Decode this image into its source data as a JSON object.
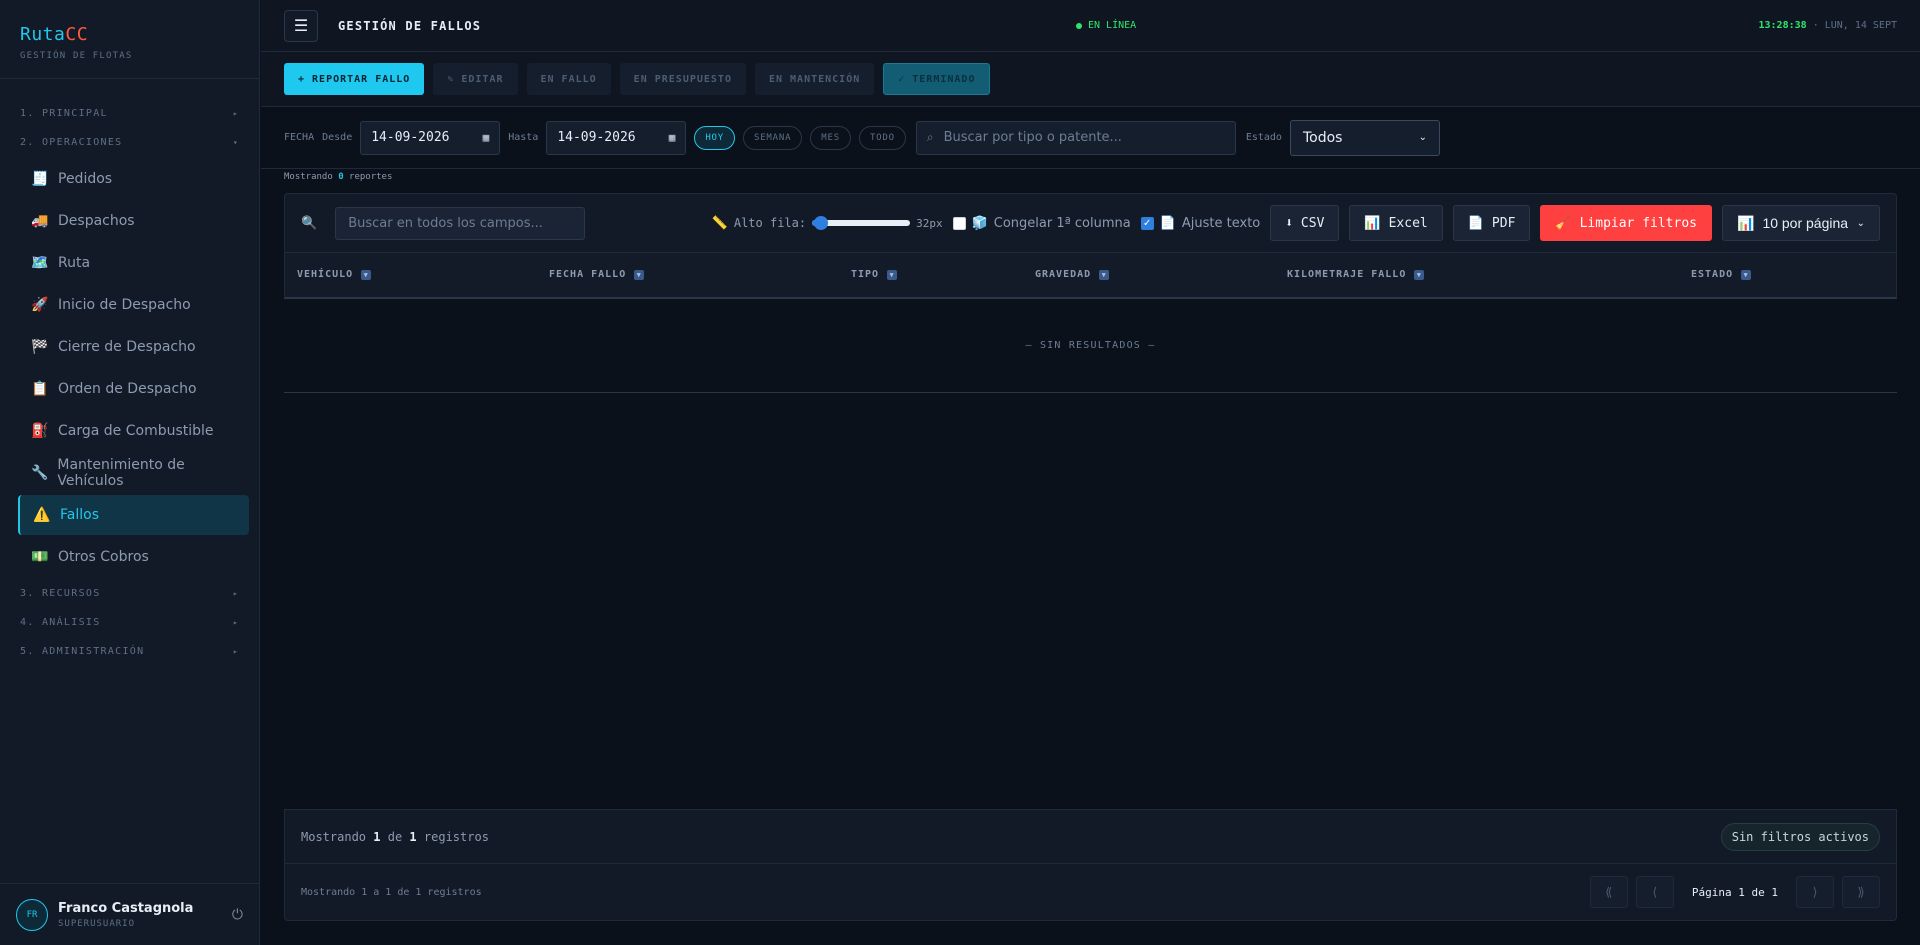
{
  "brand": {
    "name_a": "Ruta",
    "name_b": "CC",
    "subtitle": "GESTIÓN DE FLOTAS"
  },
  "sidebar": {
    "sections": [
      {
        "label": "1. PRINCIPAL",
        "arrow": "▸"
      },
      {
        "label": "2. OPERACIONES",
        "arrow": "▾"
      },
      {
        "label": "3. RECURSOS",
        "arrow": "▸"
      },
      {
        "label": "4. ANÁLISIS",
        "arrow": "▸"
      },
      {
        "label": "5. ADMINISTRACIÓN",
        "arrow": "▸"
      }
    ],
    "items": [
      {
        "label": "Pedidos",
        "icon": "🧾"
      },
      {
        "label": "Despachos",
        "icon": "🚚"
      },
      {
        "label": "Ruta",
        "icon": "🗺️"
      },
      {
        "label": "Inicio de Despacho",
        "icon": "🚀"
      },
      {
        "label": "Cierre de Despacho",
        "icon": "🏁"
      },
      {
        "label": "Orden de Despacho",
        "icon": "📋"
      },
      {
        "label": "Carga de Combustible",
        "icon": "⛽"
      },
      {
        "label": "Mantenimiento de Vehículos",
        "icon": "🔧"
      },
      {
        "label": "Fallos",
        "icon": "⚠️"
      },
      {
        "label": "Otros Cobros",
        "icon": "💵"
      }
    ]
  },
  "user": {
    "initials": "FR",
    "name": "Franco Castagnola",
    "role": "SUPERUSUARIO"
  },
  "header": {
    "title": "GESTIÓN DE FALLOS",
    "status": "EN LÍNEA",
    "time": "13:28:38",
    "date": "· LUN, 14 SEPT"
  },
  "actions": {
    "report": "+ REPORTAR FALLO",
    "edit": "✎ EDITAR",
    "in_fault": "EN FALLO",
    "in_budget": "EN PRESUPUESTO",
    "in_maintenance": "EN MANTENCIÓN",
    "done": "✓ TERMINADO"
  },
  "filters": {
    "fecha": "FECHA",
    "desde": "Desde",
    "hasta": "Hasta",
    "from_date": "14-09-2026",
    "to_date": "14-09-2026",
    "presets": [
      "HOY",
      "SEMANA",
      "MES",
      "TODO"
    ],
    "search_placeholder": "Buscar por tipo o patente...",
    "estado_label": "Estado",
    "estado_value": "Todos"
  },
  "showing": {
    "prefix": "Mostrando",
    "count": "0",
    "suffix": "reportes"
  },
  "grid": {
    "search_placeholder": "Buscar en todos los campos...",
    "row_height_label": "Alto fila:",
    "row_height_value": "32px",
    "freeze_label": "Congelar 1ª columna",
    "wrap_label": "Ajuste texto",
    "csv": "⬇ CSV",
    "excel": "Excel",
    "pdf": "PDF",
    "clear": "Limpiar filtros",
    "per_page": "10 por página",
    "columns": [
      "VEHÍCULO",
      "FECHA FALLO",
      "TIPO",
      "GRAVEDAD",
      "KILOMETRAJE FALLO",
      "ESTADO"
    ],
    "empty": "— SIN RESULTADOS —"
  },
  "footer": {
    "summary_prefix": "Mostrando",
    "summary_a": "1",
    "summary_mid": "de",
    "summary_b": "1",
    "summary_suffix": "registros",
    "badge": "Sin filtros activos",
    "range": "Mostrando 1 a 1 de 1 registros",
    "page_label": "Página 1 de 1"
  },
  "colors": {
    "accent": "#22c7e8",
    "danger": "#ff4040",
    "online": "#2ee66b"
  }
}
